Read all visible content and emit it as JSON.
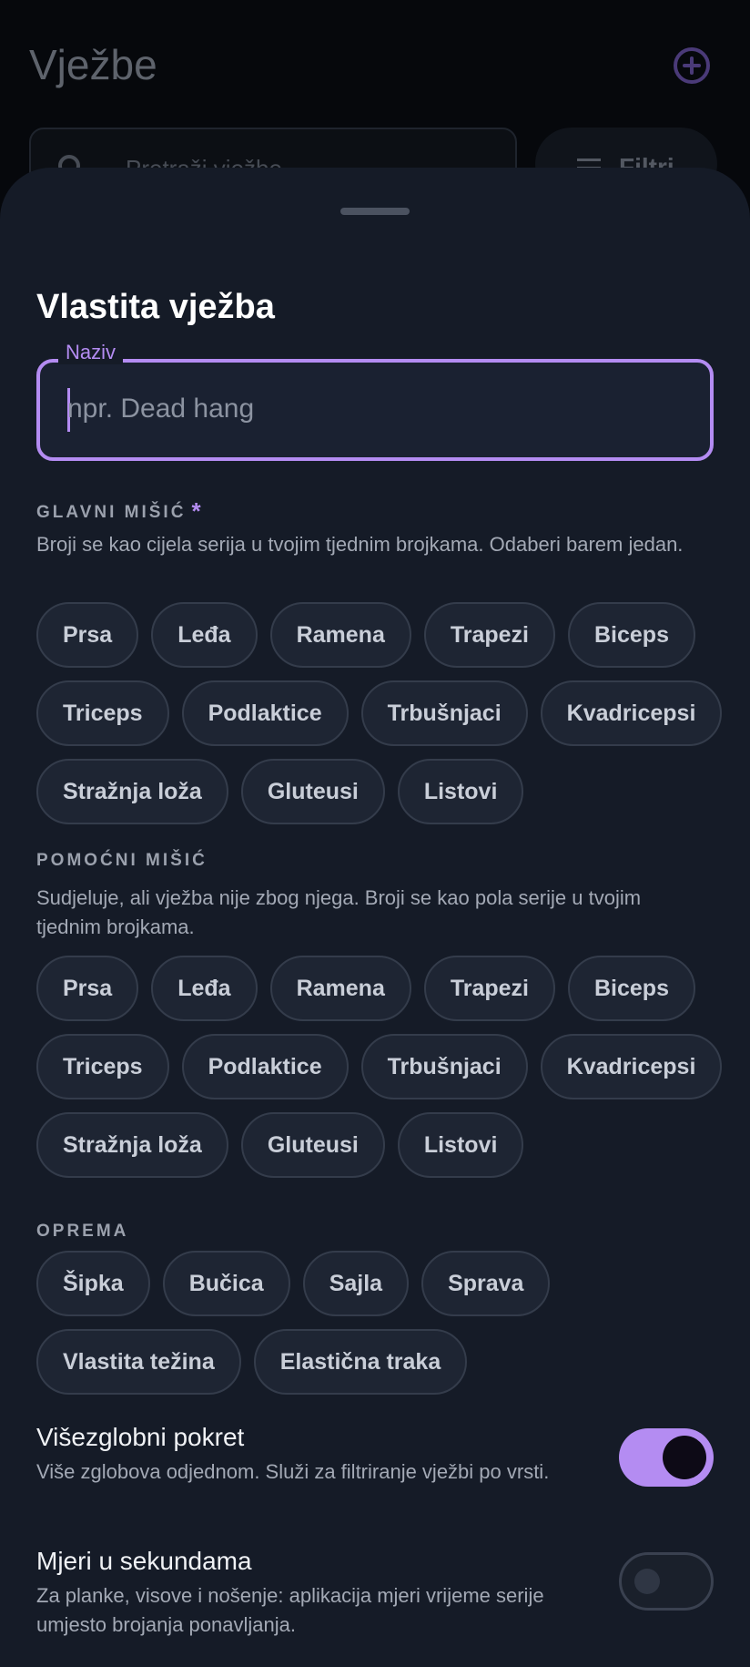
{
  "background": {
    "title": "Vježbe",
    "search_placeholder": "Pretraži vježbe",
    "filter_label": "Filtri"
  },
  "sheet": {
    "title": "Vlastita vježba",
    "name_field": {
      "label": "Naziv",
      "placeholder": "npr. Dead hang",
      "value": ""
    },
    "primary_muscle": {
      "label": "GLAVNI MIŠIĆ",
      "required_mark": "*",
      "description": "Broji se kao cijela serija u tvojim tjednim brojkama. Odaberi barem jedan.",
      "rows": [
        [
          "Prsa",
          "Leđa",
          "Ramena",
          "Trapezi",
          "Biceps"
        ],
        [
          "Triceps",
          "Podlaktice",
          "Trbušnjaci",
          "Kvadricepsi"
        ],
        [
          "Stražnja loža",
          "Gluteusi",
          "Listovi"
        ]
      ]
    },
    "secondary_muscle": {
      "label": "POMOĆNI MIŠIĆ",
      "description": "Sudjeluje, ali vježba nije zbog njega. Broji se kao pola serije u tvojim tjednim brojkama.",
      "rows": [
        [
          "Prsa",
          "Leđa",
          "Ramena",
          "Trapezi",
          "Biceps"
        ],
        [
          "Triceps",
          "Podlaktice",
          "Trbušnjaci",
          "Kvadricepsi"
        ],
        [
          "Stražnja loža",
          "Gluteusi",
          "Listovi"
        ]
      ]
    },
    "equipment": {
      "label": "OPREMA",
      "rows": [
        [
          "Šipka",
          "Bučica",
          "Sajla",
          "Sprava"
        ],
        [
          "Vlastita težina",
          "Elastična traka"
        ]
      ]
    },
    "compound": {
      "title": "Višezglobni pokret",
      "description": "Više zglobova odjednom. Služi za filtriranje vježbi po vrsti.",
      "enabled": true
    },
    "timed": {
      "title": "Mjeri u sekundama",
      "description": "Za planke, visove i nošenje: aplikacija mjeri vrijeme serije umjesto brojanja ponavljanja.",
      "enabled": false
    }
  },
  "colors": {
    "accent": "#b48cf2",
    "sheet_bg": "#151b27",
    "chip_bg": "#1e2533"
  }
}
